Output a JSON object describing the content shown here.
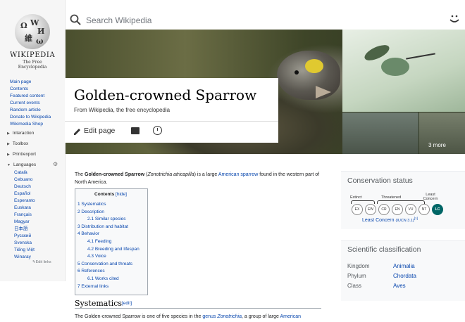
{
  "sidebar": {
    "wordmark": "WIKIPEDIA",
    "tagline": "The Free Encyclopedia",
    "nav": [
      "Main page",
      "Contents",
      "Featured content",
      "Current events",
      "Random article",
      "Donate to Wikipedia",
      "Wikimedia Shop"
    ],
    "interaction": "Interaction",
    "toolbox": "Toolbox",
    "printexport": "Print/export",
    "languages_heading": "Languages",
    "languages": [
      "Català",
      "Cebuano",
      "Deutsch",
      "Español",
      "Esperanto",
      "Euskara",
      "Français",
      "Magyar",
      "日本語",
      "Русский",
      "Svenska",
      "Tiếng Việt",
      "Winaray"
    ],
    "edit_links": "Edit links"
  },
  "search": {
    "placeholder": "Search Wikipedia"
  },
  "hero": {
    "more_label": "3 more"
  },
  "article": {
    "title": "Golden-crowned Sparrow",
    "subtitle": "From Wikipedia, the free encyclopedia",
    "edit_label": "Edit page",
    "intro_bold": "Golden-crowned Sparrow",
    "intro_sci": "Zonotrichia atricapilla",
    "intro_link": "American sparrow",
    "intro_a": "The ",
    "intro_b": " (",
    "intro_c": ") is a large ",
    "intro_d": " found in the western part of North America.",
    "section1": "Systematics",
    "section_edit": "[edit]",
    "para2_a": "The Golden-crowned Sparrow is one of five species in the ",
    "para2_link": "genus",
    "para2_b": " Zonotrichia",
    "para2_c": ", a group of large ",
    "para2_link2": "American"
  },
  "toc": {
    "title": "Contents",
    "hide": "[hide]",
    "items": [
      {
        "label": "1 Systematics",
        "sub": false
      },
      {
        "label": "2 Description",
        "sub": false
      },
      {
        "label": "2.1 Similar species",
        "sub": true
      },
      {
        "label": "3 Distribution and habitat",
        "sub": false
      },
      {
        "label": "4 Behavior",
        "sub": false
      },
      {
        "label": "4.1 Feeding",
        "sub": true
      },
      {
        "label": "4.2 Breeding and lifespan",
        "sub": true
      },
      {
        "label": "4.3 Voice",
        "sub": true
      },
      {
        "label": "5 Conservation and threats",
        "sub": false
      },
      {
        "label": "6 References",
        "sub": false
      },
      {
        "label": "6.1 Works cited",
        "sub": true
      },
      {
        "label": "7 External links",
        "sub": false
      }
    ]
  },
  "conservation": {
    "heading": "Conservation status",
    "extinct": "Extinct",
    "threatened": "Threatened",
    "least_concern_label": "Least Concern",
    "codes": [
      "EX",
      "EW",
      "CR",
      "EN",
      "VU",
      "NT",
      "LC"
    ],
    "status_link": "Least Concern",
    "iucn": "(IUCN 3.1)",
    "ref": "[1]",
    "status_color": "#006666"
  },
  "classification": {
    "heading": "Scientific classification",
    "rows": [
      {
        "rank": "Kingdom",
        "value": "Animalia"
      },
      {
        "rank": "Phylum",
        "value": "Chordata"
      },
      {
        "rank": "Class",
        "value": "Aves"
      }
    ]
  }
}
